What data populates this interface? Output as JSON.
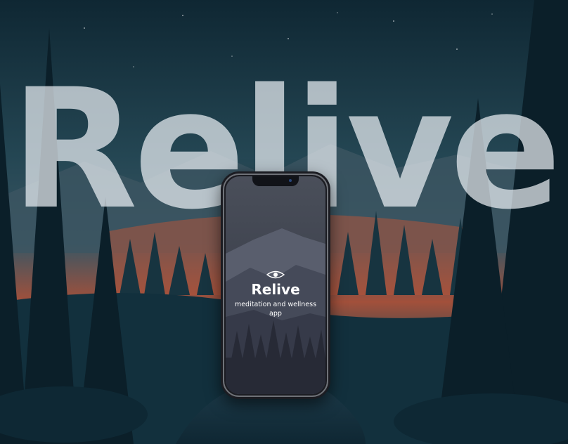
{
  "hero": {
    "title": "Relive"
  },
  "phone": {
    "app_name": "Relive",
    "tagline": "meditation and wellness app",
    "logo_icon": "eye-icon"
  },
  "colors": {
    "sky_top": "#0f2a38",
    "sky_mid": "#274a56",
    "horizon_glow": "#c65c3a",
    "forest_dark": "#0b1f29",
    "title_text": "#e9eef3",
    "phone_screen": "#3b3f4b"
  }
}
